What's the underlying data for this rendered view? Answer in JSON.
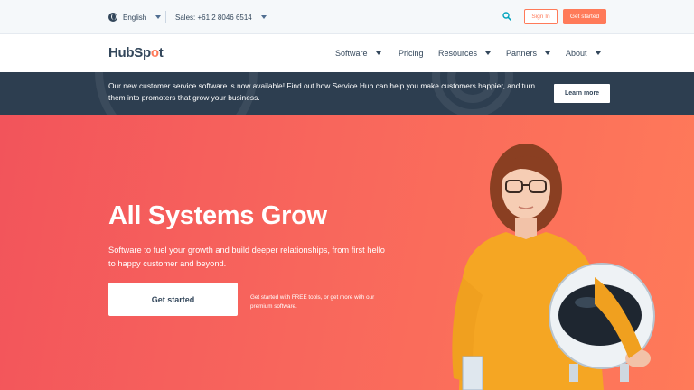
{
  "utility": {
    "language": "English",
    "sales": "Sales: +61 2 8046 6514",
    "sign_in": "Sign In",
    "get_started": "Get started"
  },
  "nav": {
    "logo": {
      "part1": "HubSp",
      "part2": "o",
      "part3": "t"
    },
    "items": [
      {
        "label": "Software",
        "has_dropdown": true
      },
      {
        "label": "Pricing",
        "has_dropdown": false
      },
      {
        "label": "Resources",
        "has_dropdown": true
      },
      {
        "label": "Partners",
        "has_dropdown": true
      },
      {
        "label": "About",
        "has_dropdown": true
      }
    ]
  },
  "announcement": {
    "text": "Our new customer service software is now available! Find out how Service Hub can help you make customers happier, and turn them into promoters that grow your business.",
    "cta": "Learn more"
  },
  "hero": {
    "title": "All Systems Grow",
    "subtitle": "Software to fuel your growth and build deeper relationships, from first hello to happy customer and beyond.",
    "cta": "Get started",
    "note": "Get started with FREE tools, or get more with our premium software."
  },
  "colors": {
    "accent": "#ff7a59",
    "hero_start": "#f2545b",
    "hero_end": "#ff7a59",
    "dark": "#2d3e50",
    "text": "#33475b"
  },
  "icons": [
    "globe-icon",
    "chevron-down-icon",
    "search-icon"
  ]
}
